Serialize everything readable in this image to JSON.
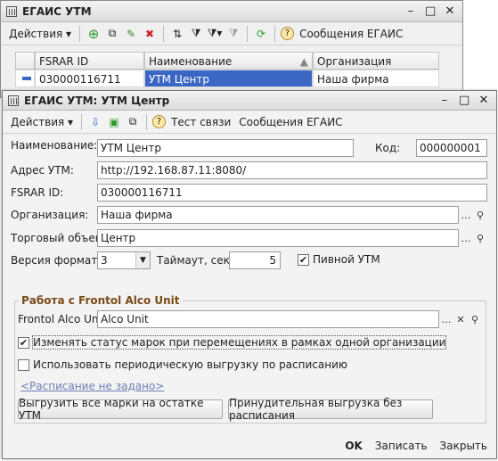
{
  "list_window": {
    "title": "ЕГАИС УТМ",
    "toolbar": {
      "actions": "Действия",
      "messages": "Сообщения ЕГАИС"
    },
    "columns": [
      "FSRAR ID",
      "Наименование",
      "Организация"
    ],
    "row": {
      "fsrar_id": "030000116711",
      "name": "УТМ Центр",
      "org": "Наша фирма"
    }
  },
  "form_window": {
    "title": "ЕГАИС УТМ: УТМ Центр",
    "toolbar": {
      "actions": "Действия",
      "test": "Тест связи",
      "messages": "Сообщения ЕГАИС"
    },
    "fields": {
      "name_label": "Наименование:",
      "name_value": "УТМ Центр",
      "code_label": "Код:",
      "code_value": "000000001",
      "address_label": "Адрес УТМ:",
      "address_value": "http://192.168.87.11:8080/",
      "fsrar_label": "FSRAR ID:",
      "fsrar_value": "030000116711",
      "org_label": "Организация:",
      "org_value": "Наша фирма",
      "shop_label": "Торговый объект:",
      "shop_value": "Центр",
      "format_label": "Версия формата:",
      "format_value": "3",
      "timeout_label": "Таймаут, сек.:",
      "timeout_value": "5",
      "beer_label": "Пивной УТМ"
    },
    "frontol": {
      "group_title": "Работа с Frontol Alco Unit",
      "unit_label": "Frontol Alco Unit:",
      "unit_value": "Alco Unit",
      "change_status": "Изменять статус марок при перемещениях в рамках одной организации",
      "periodic": "Использовать периодическую выгрузку по расписанию",
      "schedule_link": "<Расписание не задано>",
      "upload_all": "Выгрузить все марки на остатке УТМ",
      "force_upload": "Принудительная выгрузка без расписания"
    },
    "footer": {
      "ok": "OK",
      "save": "Записать",
      "close": "Закрыть"
    },
    "checkboxes": {
      "beer": true,
      "change_status": true,
      "periodic": false
    }
  },
  "colors": {
    "selection": "#3a66c4",
    "accent_green": "#2e9a2e",
    "group_title": "#7a4b1a"
  }
}
